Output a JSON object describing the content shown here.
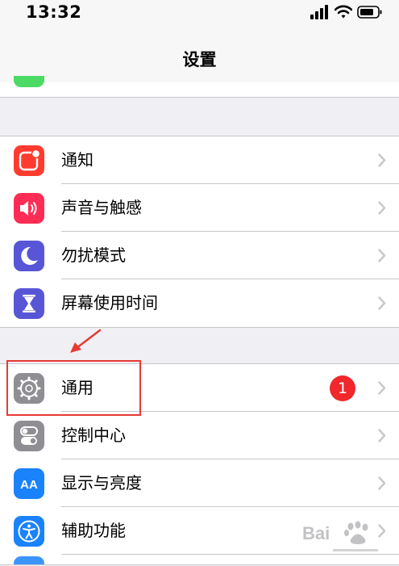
{
  "status_bar": {
    "time": "13:32",
    "icons": [
      "cellular-signal-icon",
      "wifi-icon",
      "battery-icon"
    ]
  },
  "nav": {
    "title": "设置"
  },
  "groups": [
    {
      "items": [
        {
          "label": "通知",
          "icon": "notifications-icon",
          "color": "#ff3b30"
        },
        {
          "label": "声音与触感",
          "icon": "speaker-icon",
          "color": "#ff2d55"
        },
        {
          "label": "勿扰模式",
          "icon": "moon-icon",
          "color": "#5856d6"
        },
        {
          "label": "屏幕使用时间",
          "icon": "hourglass-icon",
          "color": "#5856d6"
        }
      ]
    },
    {
      "items": [
        {
          "label": "通用",
          "icon": "gear-icon",
          "color": "#8e8e93",
          "badge": "1"
        },
        {
          "label": "控制中心",
          "icon": "toggle-switches-icon",
          "color": "#8e8e93"
        },
        {
          "label": "显示与亮度",
          "icon": "text-size-icon",
          "color": "#1a82fb",
          "icon_text": "AA"
        },
        {
          "label": "辅助功能",
          "icon": "accessibility-icon",
          "color": "#1a82fb"
        }
      ]
    }
  ],
  "annotation": {
    "highlight_color": "#e63a33"
  },
  "watermark": {
    "text": "Bai",
    "logo": "baidu-paw-logo-icon"
  }
}
